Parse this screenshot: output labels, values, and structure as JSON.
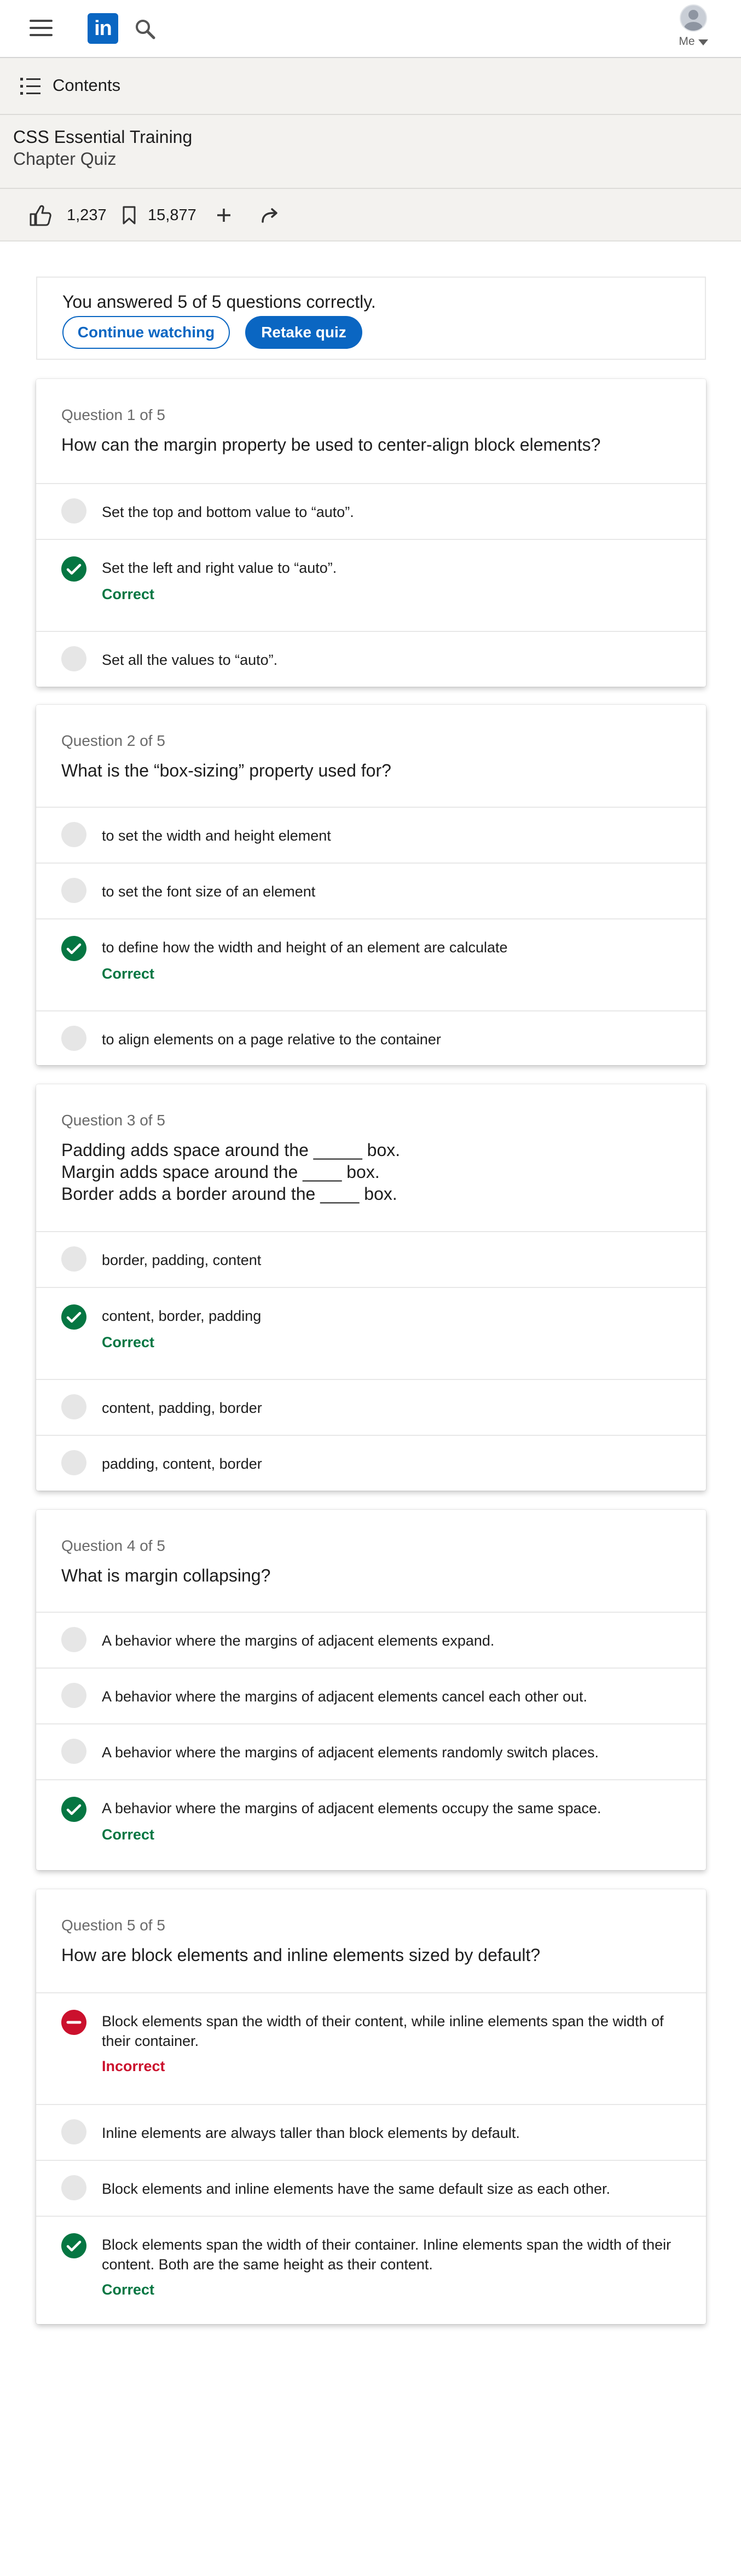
{
  "nav": {
    "logo_text": "in",
    "me_label": "Me"
  },
  "course": {
    "contents_label": "Contents",
    "title": "CSS Essential Training",
    "chapter": "Chapter Quiz",
    "likes": "1,237",
    "saves": "15,877"
  },
  "result": {
    "summary": "You answered 5 of 5 questions correctly.",
    "continue_label": "Continue watching",
    "retake_label": "Retake quiz"
  },
  "colors": {
    "brand": "#0a66c2",
    "correct": "#057642",
    "incorrect": "#cb112d"
  },
  "questions": [
    {
      "number_label": "Question 1 of 5",
      "text": "How can the margin property be used to center-align block elements?",
      "options": [
        {
          "text": "Set the top and bottom value to “auto”.",
          "state": "unselected"
        },
        {
          "text": "Set the left and right value to “auto”.",
          "state": "correct",
          "status": "Correct"
        },
        {
          "text": "Set all the values to “auto”.",
          "state": "unselected"
        }
      ]
    },
    {
      "number_label": "Question 2 of 5",
      "text": "What is the “box-sizing” property used for?",
      "options": [
        {
          "text": "to set the width and height element",
          "state": "unselected"
        },
        {
          "text": "to set the font size of an element",
          "state": "unselected"
        },
        {
          "text": "to define how the width and height of an element are calculate",
          "state": "correct",
          "status": "Correct"
        },
        {
          "text": "to align elements on a page relative to the container",
          "state": "unselected"
        }
      ]
    },
    {
      "number_label": "Question 3 of 5",
      "text": "Padding adds space around the _____ box.\nMargin adds space around the ____ box.\nBorder adds a border around the ____ box.",
      "options": [
        {
          "text": "border, padding, content",
          "state": "unselected"
        },
        {
          "text": "content, border, padding",
          "state": "correct",
          "status": "Correct"
        },
        {
          "text": "content, padding, border",
          "state": "unselected"
        },
        {
          "text": "padding, content, border",
          "state": "unselected"
        }
      ]
    },
    {
      "number_label": "Question 4 of 5",
      "text": "What is margin collapsing?",
      "options": [
        {
          "text": "A behavior where the margins of adjacent elements expand.",
          "state": "unselected"
        },
        {
          "text": "A behavior where the margins of adjacent elements cancel each other out.",
          "state": "unselected"
        },
        {
          "text": "A behavior where the margins of adjacent elements randomly switch places.",
          "state": "unselected"
        },
        {
          "text": "A behavior where the margins of adjacent elements occupy the same space.",
          "state": "correct",
          "status": "Correct"
        }
      ]
    },
    {
      "number_label": "Question 5 of 5",
      "text": "How are block elements and inline elements sized by default?",
      "options": [
        {
          "text": "Block elements span the width of their content, while inline elements span the width of their container.",
          "state": "incorrect",
          "status": "Incorrect"
        },
        {
          "text": "Inline elements are always taller than block elements by default.",
          "state": "unselected"
        },
        {
          "text": "Block elements and inline elements have the same default size as each other.",
          "state": "unselected"
        },
        {
          "text": "Block elements span the width of their container. Inline elements span the width of their content. Both are the same height as their content.",
          "state": "correct",
          "status": "Correct"
        }
      ]
    }
  ]
}
